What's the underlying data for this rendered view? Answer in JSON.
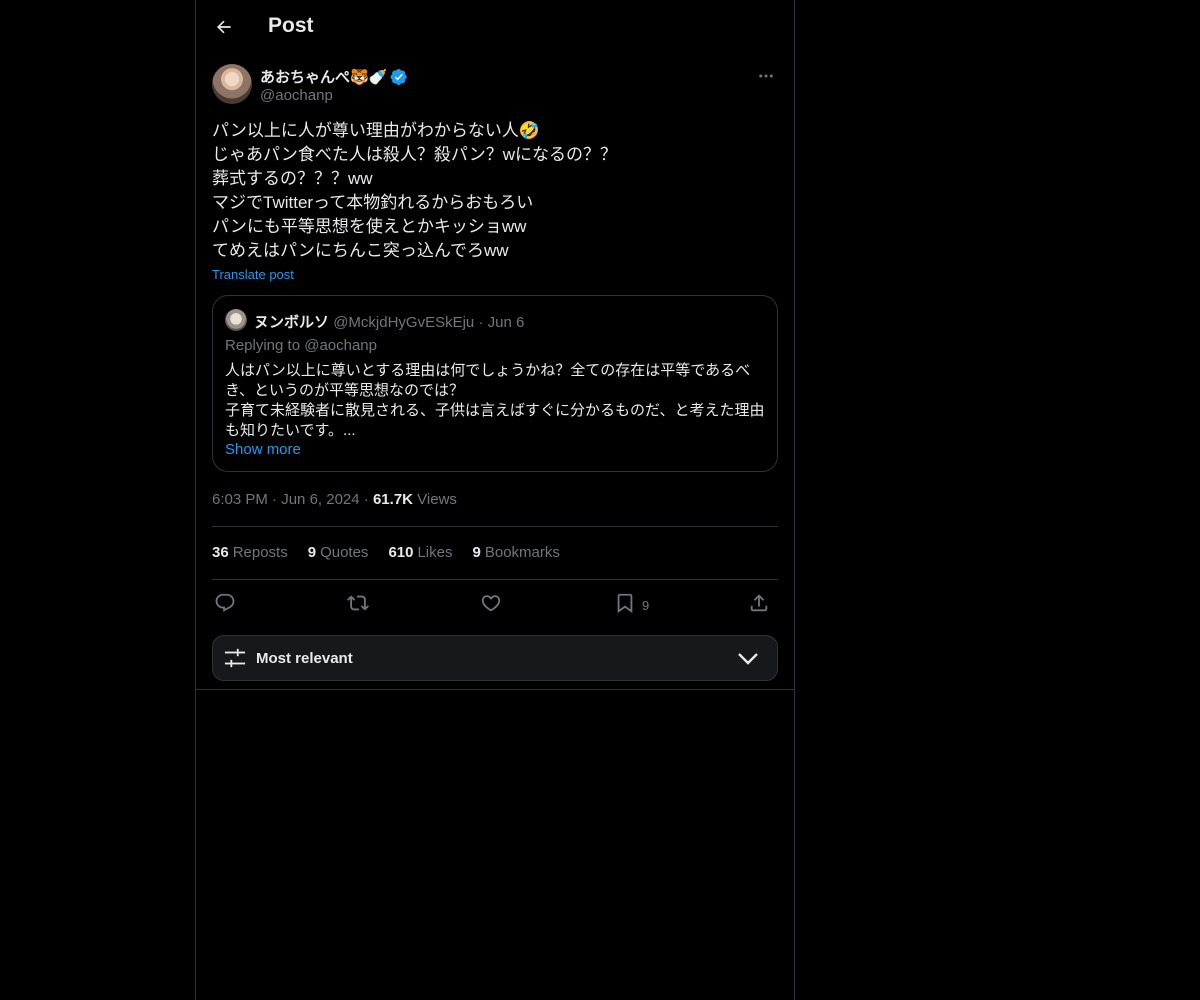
{
  "header": {
    "title": "Post",
    "back_icon": "arrow-left-icon"
  },
  "post": {
    "author_name": "あおちゃんぺ🐯🍼",
    "author_handle": "@aochanp",
    "verified": true,
    "text": "パン以上に人が尊い理由がわからない人🤣\nじゃあパン食べた人は殺人？殺パン？wになるの？？\n葬式するの？？？ww\nマジでTwitterって本物釣れるからおもろい\nパンにも平等思想を使えとかキッショww\nてめえはパンにちんこ突っ込んでろww",
    "translate_label": "Translate post",
    "time": "6:03 PM",
    "date": "Jun 6, 2024",
    "views_count": "61.7K",
    "views_label": "Views",
    "sep": "·"
  },
  "quote": {
    "name": "ヌンボルソ",
    "handle": "@MckjdHyGvESkEju",
    "date": "Jun 6",
    "replying_to": "Replying to @aochanp",
    "text": "人はパン以上に尊いとする理由は何でしょうかね？全ての存在は平等であるべき、というのが平等思想なのでは？\n子育て未経験者に散見される、子供は言えばすぐに分かるものだ、と考えた理由も知りたいです。...",
    "show_more": "Show more"
  },
  "stats": {
    "reposts_count": "36",
    "reposts_label": "Reposts",
    "quotes_count": "9",
    "quotes_label": "Quotes",
    "likes_count": "610",
    "likes_label": "Likes",
    "bookmarks_count": "9",
    "bookmarks_label": "Bookmarks"
  },
  "actions": {
    "bookmark_count": "9"
  },
  "sort": {
    "label": "Most relevant"
  },
  "colors": {
    "background": "#000000",
    "text": "#e7e9ea",
    "muted": "#71767b",
    "accent": "#1d9bf0",
    "border": "#2f3336"
  }
}
